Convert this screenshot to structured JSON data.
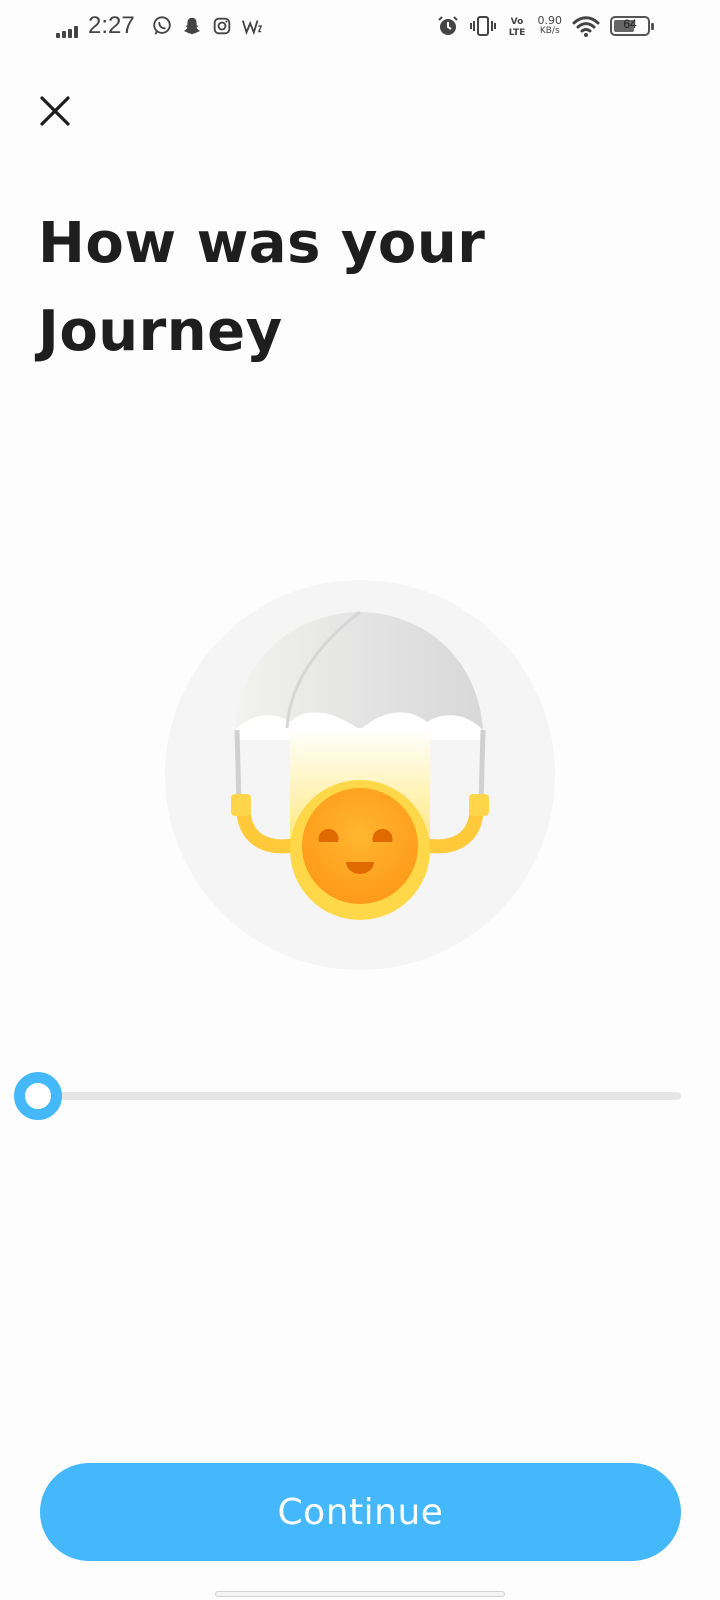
{
  "status_bar": {
    "time": "2:27",
    "net_speed_value": "0.90",
    "net_speed_unit": "KB/s",
    "volte_label": "Vo)) LTE",
    "battery_level": "64",
    "icons": [
      "signal-icon",
      "whatsapp-icon",
      "snapchat-icon",
      "instagram-icon",
      "w-app-icon",
      "alarm-icon",
      "vibrate-icon",
      "volte-icon",
      "wifi-icon",
      "battery-icon"
    ]
  },
  "header": {
    "close_icon": "close-icon",
    "title": "How was your Journey"
  },
  "rating": {
    "slider_value_fraction": 0.0,
    "illustration": "parachute-smiley-illustration"
  },
  "footer": {
    "continue_label": "Continue"
  },
  "colors": {
    "accent": "#45b8fc",
    "title": "#1e1e1e",
    "background": "#fdfdfd",
    "track": "#e6e6e6"
  }
}
